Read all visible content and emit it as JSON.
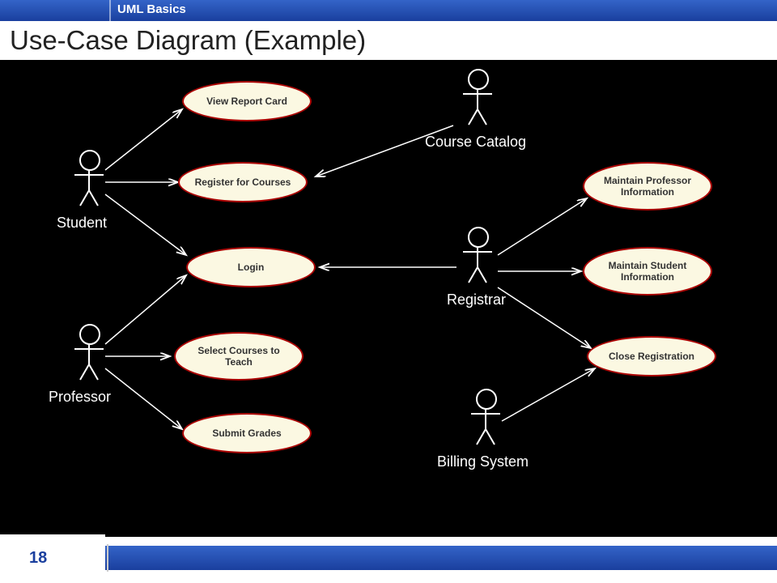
{
  "header": {
    "section": "UML Basics",
    "title": "Use-Case Diagram (Example)"
  },
  "actors": {
    "student": "Student",
    "professor": "Professor",
    "course_catalog": "Course Catalog",
    "registrar": "Registrar",
    "billing_system": "Billing System"
  },
  "usecases": {
    "view_report_card": "View Report Card",
    "register_for_courses": "Register for Courses",
    "login": "Login",
    "select_courses_to_teach": "Select Courses to Teach",
    "submit_grades": "Submit Grades",
    "maintain_professor_info": "Maintain Professor Information",
    "maintain_student_info": "Maintain Student Information",
    "close_registration": "Close Registration"
  },
  "footer": {
    "page_number": "18"
  },
  "diagram_data": {
    "type": "uml-use-case",
    "actors": [
      "Student",
      "Professor",
      "Course Catalog",
      "Registrar",
      "Billing System"
    ],
    "use_cases": [
      "View Report Card",
      "Register for Courses",
      "Login",
      "Select Courses to Teach",
      "Submit Grades",
      "Maintain Professor Information",
      "Maintain Student Information",
      "Close Registration"
    ],
    "associations": [
      [
        "Student",
        "View Report Card"
      ],
      [
        "Student",
        "Register for Courses"
      ],
      [
        "Student",
        "Login"
      ],
      [
        "Professor",
        "Login"
      ],
      [
        "Professor",
        "Select Courses to Teach"
      ],
      [
        "Professor",
        "Submit Grades"
      ],
      [
        "Course Catalog",
        "Register for Courses"
      ],
      [
        "Registrar",
        "Login"
      ],
      [
        "Registrar",
        "Maintain Professor Information"
      ],
      [
        "Registrar",
        "Maintain Student Information"
      ],
      [
        "Registrar",
        "Close Registration"
      ],
      [
        "Billing System",
        "Close Registration"
      ]
    ]
  }
}
